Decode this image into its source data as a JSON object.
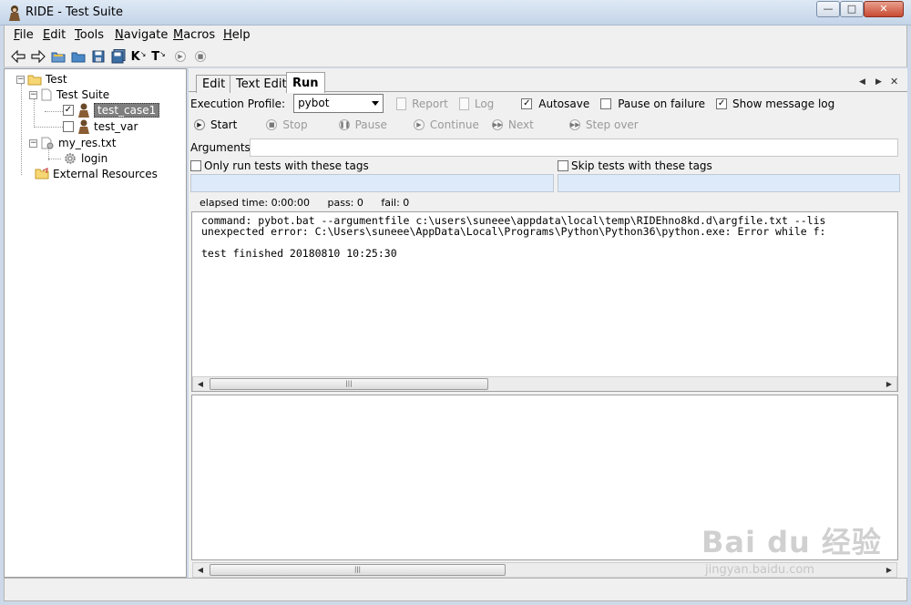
{
  "window": {
    "title": "RIDE - Test Suite"
  },
  "menu": [
    {
      "key": "F",
      "rest": "ile"
    },
    {
      "key": "E",
      "rest": "dit"
    },
    {
      "key": "T",
      "rest": "ools"
    },
    {
      "key": "N",
      "rest": "avigate"
    },
    {
      "key": "M",
      "rest": "acros"
    },
    {
      "key": "H",
      "rest": "elp"
    }
  ],
  "toolbar": {
    "icons": [
      "back-arrow-icon",
      "forward-arrow-icon",
      "open-folder-icon",
      "open-directory-icon",
      "save-icon",
      "save-all-icon",
      "keyword-search-icon",
      "test-search-icon",
      "run-icon",
      "stop-icon"
    ],
    "k_label": "K",
    "t_label": "T"
  },
  "tree": {
    "root": "Test",
    "suite": "Test Suite",
    "case1": "test_case1",
    "case2": "test_var",
    "resource": "my_res.txt",
    "keyword": "login",
    "external": "External Resources",
    "case1_checked": true,
    "case2_checked": false
  },
  "tabs": {
    "edit": "Edit",
    "text_edit": "Text Edit",
    "run": "Run",
    "active": "Run"
  },
  "run": {
    "profile_label": "Execution Profile:",
    "profile_value": "pybot",
    "report": "Report",
    "log": "Log",
    "autosave": "Autosave",
    "autosave_checked": true,
    "pause_on_failure": "Pause on failure",
    "pause_checked": false,
    "show_message_log": "Show message log",
    "show_log_checked": true,
    "start": "Start",
    "stop": "Stop",
    "pause": "Pause",
    "continue": "Continue",
    "next": "Next",
    "step_over": "Step over",
    "arguments_label": "Arguments:",
    "arguments_value": "",
    "only_run_tags": "Only run tests with these tags",
    "skip_tags": "Skip tests with these tags",
    "elapsed": "elapsed time: 0:00:00",
    "pass": "pass: 0",
    "fail": "fail: 0"
  },
  "console": {
    "line1": "command: pybot.bat --argumentfile c:\\users\\suneee\\appdata\\local\\temp\\RIDEhno8kd.d\\argfile.txt --lis",
    "line2": "unexpected error: C:\\Users\\suneee\\AppData\\Local\\Programs\\Python\\Python36\\python.exe: Error while f:",
    "line3": "",
    "line4": "test finished 20180810 10:25:30"
  },
  "watermark": {
    "brand": "Bai du 经验",
    "url": "jingyan.baidu.com"
  }
}
